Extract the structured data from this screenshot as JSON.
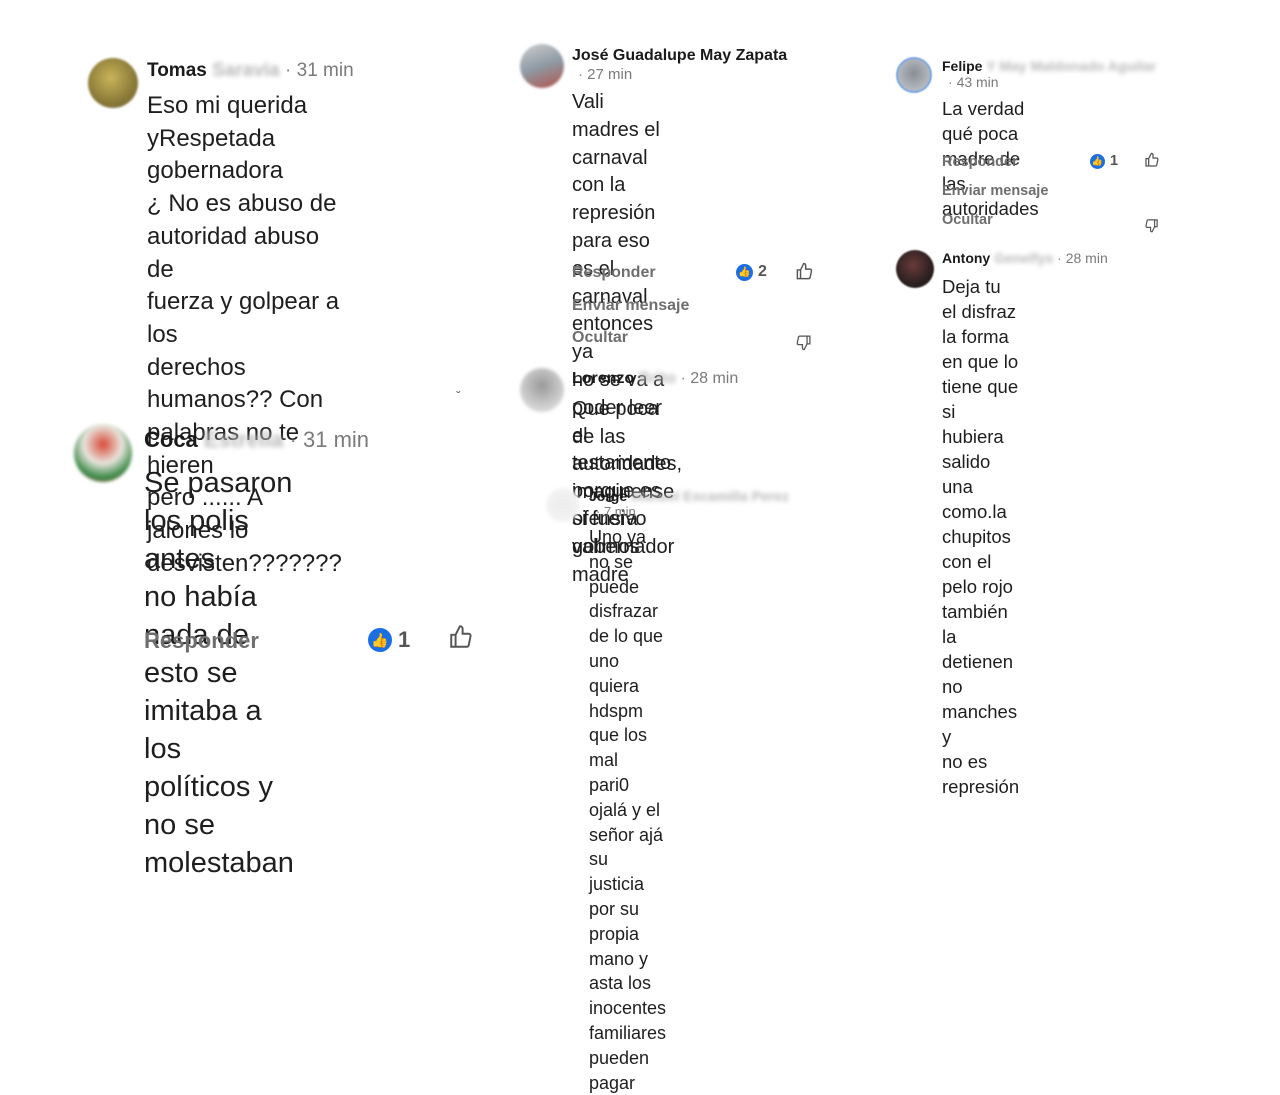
{
  "comments": {
    "c1": {
      "name": "Tomas",
      "name_hidden": "Saravia",
      "time": "31 min",
      "text": "Eso mi querida\nyRespetada gobernadora\n¿ No es abuso de\nautoridad abuso de\nfuerza y golpear a los\nderechos humanos?? Con\npalabras no te hieren\npero ...... A jalones lo\ndesvisten???????"
    },
    "c2": {
      "name": "Coca",
      "name_hidden": "Estrella",
      "time": "31 min",
      "text": "Se pasaron los polis antes\nno había nada de esto se\nimitaba a los políticos y\nno se molestaban",
      "reply_label": "Responder",
      "likes": "1"
    },
    "c3": {
      "name": "José Guadalupe May Zapata",
      "time": "27 min",
      "text": "Vali madres el carnaval\ncon la represión para eso\nes el carnaval entonces ya\nno se va a poder leer el\ntestamento porque es\nofensivo valimos madre",
      "reply_label": "Responder",
      "likes": "2",
      "message_label": "Enviar mensaje",
      "hide_label": "Ocultar"
    },
    "c4": {
      "name": "Lorenzo",
      "name_hidden": "Brito",
      "time": "28 min",
      "text": "Que poca de las\nautoridades, imaginense\nsi fuera gobernador"
    },
    "c5": {
      "name": "Jorge",
      "name_hidden": "Manuel Escamilla Perez",
      "time": "7 min",
      "text": "Uno ya no se puede\ndisfrazar de lo que uno\nquiera hdspm que los mal\npari0 ojalá y el señor ajá\nsu justicia por su propia\nmano y asta los inocentes\nfamiliares pueden pagar"
    },
    "c6": {
      "name": "Felipe",
      "name_hidden": "Y May Maldonado Aguilar",
      "time": "43 min",
      "text": "La verdad qué poca\nmadre de las autoridades",
      "reply_label": "Responder",
      "likes": "1",
      "message_label": "Enviar mensaje",
      "hide_label": "Ocultar"
    },
    "c7": {
      "name": "Antony",
      "name_hidden": "Genelfys",
      "time": "28 min",
      "text": "Deja tu el disfraz la forma\nen que lo tiene que si\nhubiera salido una\ncomo.la chupitos con el\npelo rojo también la\ndetienen no manches y\nno es represión"
    }
  },
  "icons": {
    "like": "thumbs-up-icon",
    "dislike": "thumbs-down-icon",
    "badge": "like-badge-icon"
  },
  "colors": {
    "accent": "#1b6fe3",
    "muted": "#6e6e6e"
  }
}
